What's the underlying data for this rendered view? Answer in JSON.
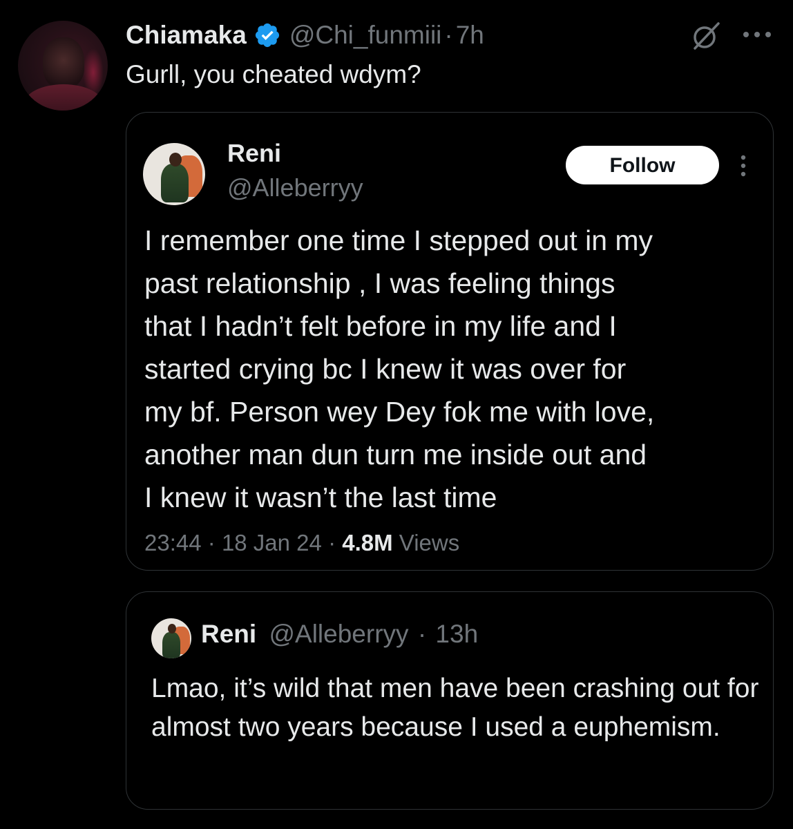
{
  "tweet": {
    "author": {
      "display_name": "Chiamaka",
      "handle": "@Chi_funmiii",
      "separator": "·",
      "time": "7h",
      "verified": true
    },
    "text": "Gurll, you cheated wdym?",
    "icons": {
      "grok": "grok-slash-icon",
      "more": "more-horizontal-icon"
    }
  },
  "quote": {
    "author": {
      "display_name": "Reni",
      "handle": "@Alleberryy"
    },
    "follow_label": "Follow",
    "text_lines": [
      "I remember one time I stepped out in my",
      "past relationship , I was feeling things",
      "that I hadn’t felt before in my life and I",
      "started crying bc I knew it was over for",
      "my bf. Person wey Dey fok me with love,",
      "another man dun turn me inside out and",
      "I knew it wasn’t the last time"
    ],
    "meta": {
      "time": "23:44",
      "separator": "·",
      "date": "18 Jan 24",
      "views_count": "4.8M",
      "views_label": "Views"
    }
  },
  "reply": {
    "author": {
      "display_name": "Reni",
      "handle": "@Alleberryy",
      "separator": "·",
      "time": "13h"
    },
    "text": "Lmao, it’s wild that men have been crashing out for almost two years because I used a euphemism."
  },
  "colors": {
    "background": "#000000",
    "text_primary": "#e7e9ea",
    "text_secondary": "#71767b",
    "border": "#2f3336",
    "verified_blue": "#1d9bf0"
  }
}
